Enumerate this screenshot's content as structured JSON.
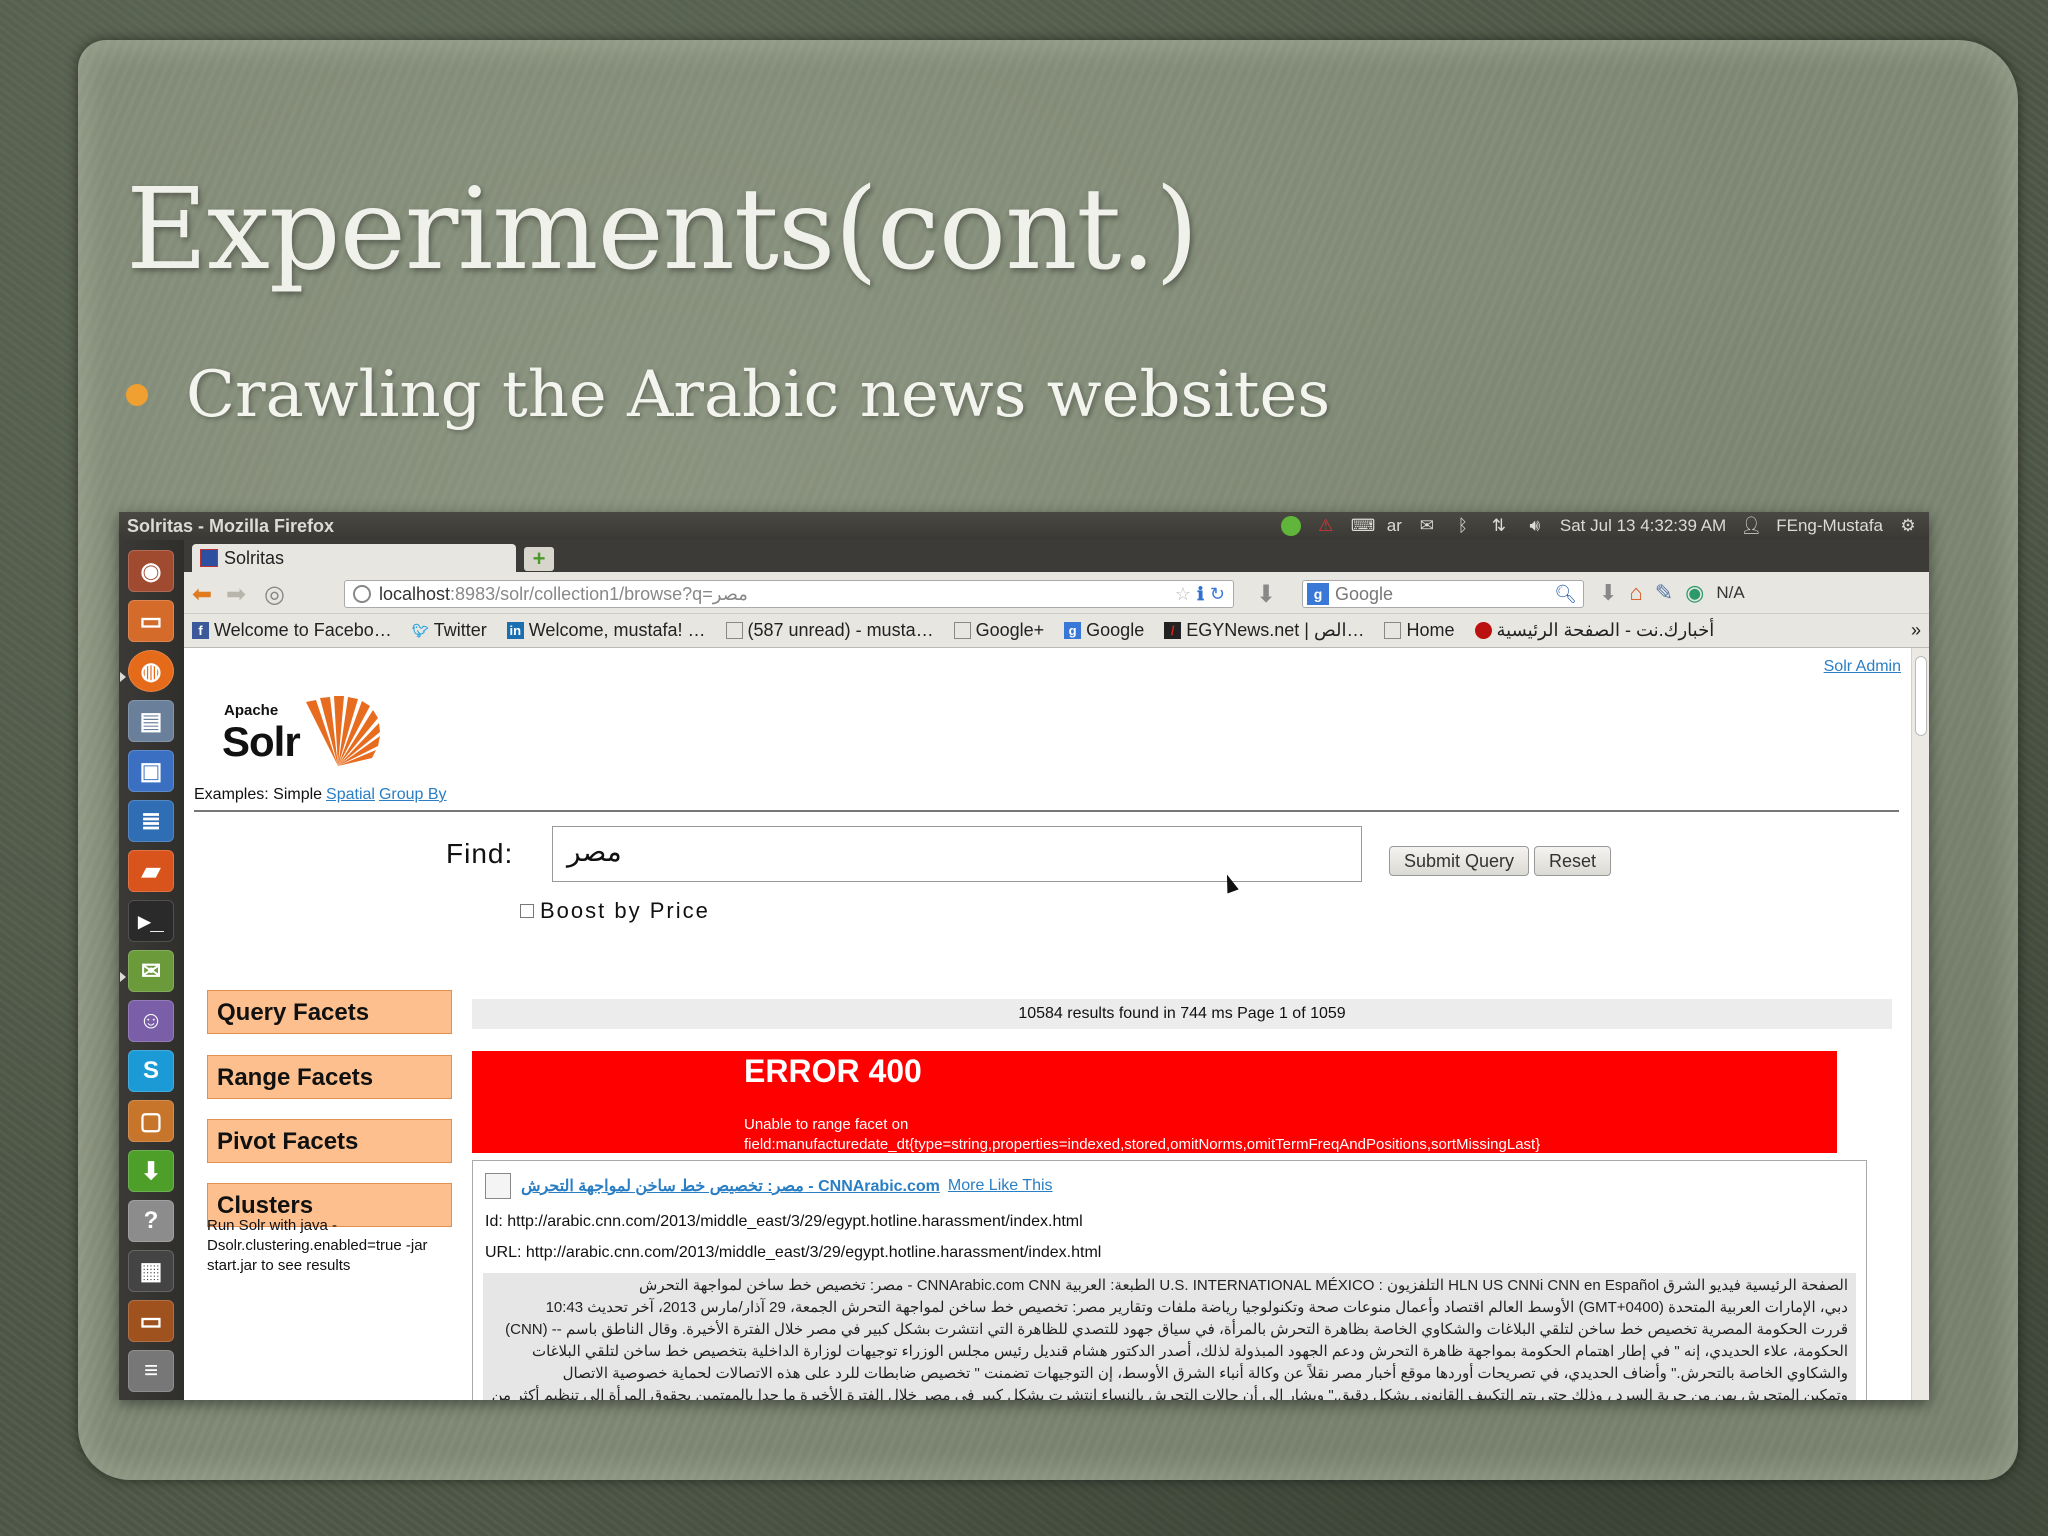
{
  "slide": {
    "title": "Experiments(cont.)",
    "bullet": "Crawling the Arabic news websites"
  },
  "colors": {
    "bullet_dot": "#f0a030",
    "facet_bg": "#fcbf8d",
    "error_bg": "#ff0000",
    "link": "#2a7ec4"
  },
  "topbar": {
    "window_title": "Solritas - Mozilla Firefox",
    "keyboard": "ar",
    "datetime": "Sat Jul 13  4:32:39 AM",
    "user": "FEng-Mustafa",
    "tray_icons": [
      "chat-icon",
      "warning-icon",
      "keyboard-icon",
      "mail-icon",
      "bluetooth-icon",
      "network-icon",
      "volume-icon",
      "user-icon",
      "gear-icon"
    ]
  },
  "browser": {
    "tab_title": "Solritas",
    "url_host": "localhost",
    "url_rest": ":8983/solr/collection1/browse?q=مصر",
    "search_placeholder": "Google",
    "status_right": "N/A",
    "bookmarks": [
      "Welcome to Facebo…",
      "Twitter",
      "Welcome, mustafa! …",
      "(587 unread) - musta…",
      "Google+",
      "Google",
      "EGYNews.net | الص…",
      "Home",
      "أخبارك.نت - الصفحة الرئيسية"
    ],
    "bookmarks_more": "»"
  },
  "solr": {
    "admin_link": "Solr Admin",
    "logo_apache": "Apache",
    "logo_solr": "Solr",
    "examples_label": "Examples: Simple",
    "examples_links": [
      "Spatial",
      "Group By"
    ],
    "find_label": "Find:",
    "query": "مصر",
    "submit_label": "Submit Query",
    "reset_label": "Reset",
    "boost_label": "Boost by Price",
    "facets": [
      "Query Facets",
      "Range Facets",
      "Pivot Facets",
      "Clusters"
    ],
    "cluster_note": "Run Solr with java -Dsolr.clustering.enabled=true -jar start.jar to see results",
    "results_summary": "10584 results found in 744 ms Page 1 of 1059",
    "error_title": "ERROR 400",
    "error_message_1": "Unable to range facet on",
    "error_message_2": "field:manufacturedate_dt{type=string,properties=indexed,stored,omitNorms,omitTermFreqAndPositions,sortMissingLast}",
    "doc_title": "مصر: تخصيص خط ساخن لمواجهة التحرش - CNNArabic.com",
    "more_like_this": "More Like This",
    "doc_id": "Id: http://arabic.cnn.com/2013/middle_east/3/29/egypt.hotline.harassment/index.html",
    "doc_url": "URL: http://arabic.cnn.com/2013/middle_east/3/29/egypt.hotline.harassment/index.html",
    "doc_body": [
      "الصفحة الرئيسية فيديو الشرق HLN US CNNi CNN en Español التلفزيون : U.S. INTERNATIONAL MÉXICO الطبعة: العربية CNNArabic.com CNN - مصر: تخصيص خط ساخن لمواجهة التحرش",
      "دبي، الإمارات العربية المتحدة (GMT+0400) الأوسط العالم اقتصاد وأعمال منوعات صحة وتكنولوجيا رياضة ملفات وتقارير مصر: تخصيص خط ساخن لمواجهة التحرش الجمعة، 29 آذار/مارس 2013، آخر تحديث 10:43",
      "قررت الحكومة المصرية تخصيص خط ساخن لتلقي البلاغات والشكاوي الخاصة بظاهرة التحرش بالمرأة، في سياق جهود للتصدي للظاهرة التي انتشرت بشكل كبير في مصر خلال الفترة الأخيرة. وقال الناطق باسم -- (CNN)",
      "الحكومة، علاء الحديدي، إنه \" في إطار اهتمام الحكومة بمواجهة ظاهرة التحرش ودعم الجهود المبذولة لذلك، أصدر الدكتور هشام قنديل رئيس مجلس الوزراء توجيهات لوزارة الداخلية بتخصيص خط ساخن لتلقي البلاغات",
      "والشكاوي الخاصة بالتحرش.\" وأضاف الحديدي، في تصريحات أوردها موقع أخبار مصر نقلاً عن وكالة أنباء الشرق الأوسط، إن التوجيهات تضمنت \" تخصيص ضابطات للرد على هذه الاتصالات لحماية خصوصية الاتصال",
      "وتمكين المتحرش بهن من حرية السرد ، وذلك حتى يتم التكييف القانوني بشكل دقيق.\" ويشار إلى أن حالات التحرش بالنساء انتشرت بشكل كبير في مصر خلال الفترة الأخيرة ما حدا بالمهتمين بحقوق المرأة إلى تنظيم أكثر من"
    ]
  }
}
